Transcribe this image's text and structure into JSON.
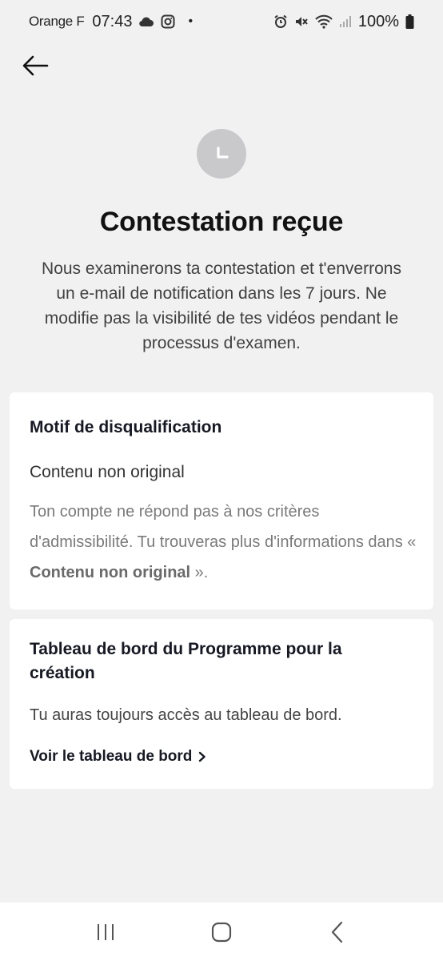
{
  "status_bar": {
    "carrier": "Orange F",
    "time": "07:43",
    "dot": "•",
    "battery": "100%"
  },
  "header": {
    "back_icon": "arrow-left-icon"
  },
  "confirmation": {
    "badge_icon": "clock-icon",
    "title": "Contestation reçue",
    "message": "Nous examinerons ta contestation et t'enverrons un e-mail de notification dans les 7 jours. Ne modifie pas la visibilité de tes vidéos pendant le processus d'examen."
  },
  "disqualification_card": {
    "title": "Motif de disqualification",
    "reason": "Contenu non original",
    "description_prefix": "Ton compte ne répond pas à nos critères d'admissibilité. Tu trouveras plus d'informations dans « ",
    "description_link": "Contenu non original",
    "description_suffix": " »."
  },
  "dashboard_card": {
    "title": "Tableau de bord du Programme pour la création",
    "description": "Tu auras toujours accès au tableau de bord.",
    "link_label": "Voir le tableau de bord",
    "link_icon": "chevron-right-icon"
  },
  "nav_bar": {
    "recents_icon": "recents-icon",
    "home_icon": "home-icon",
    "back_icon": "back-icon"
  }
}
